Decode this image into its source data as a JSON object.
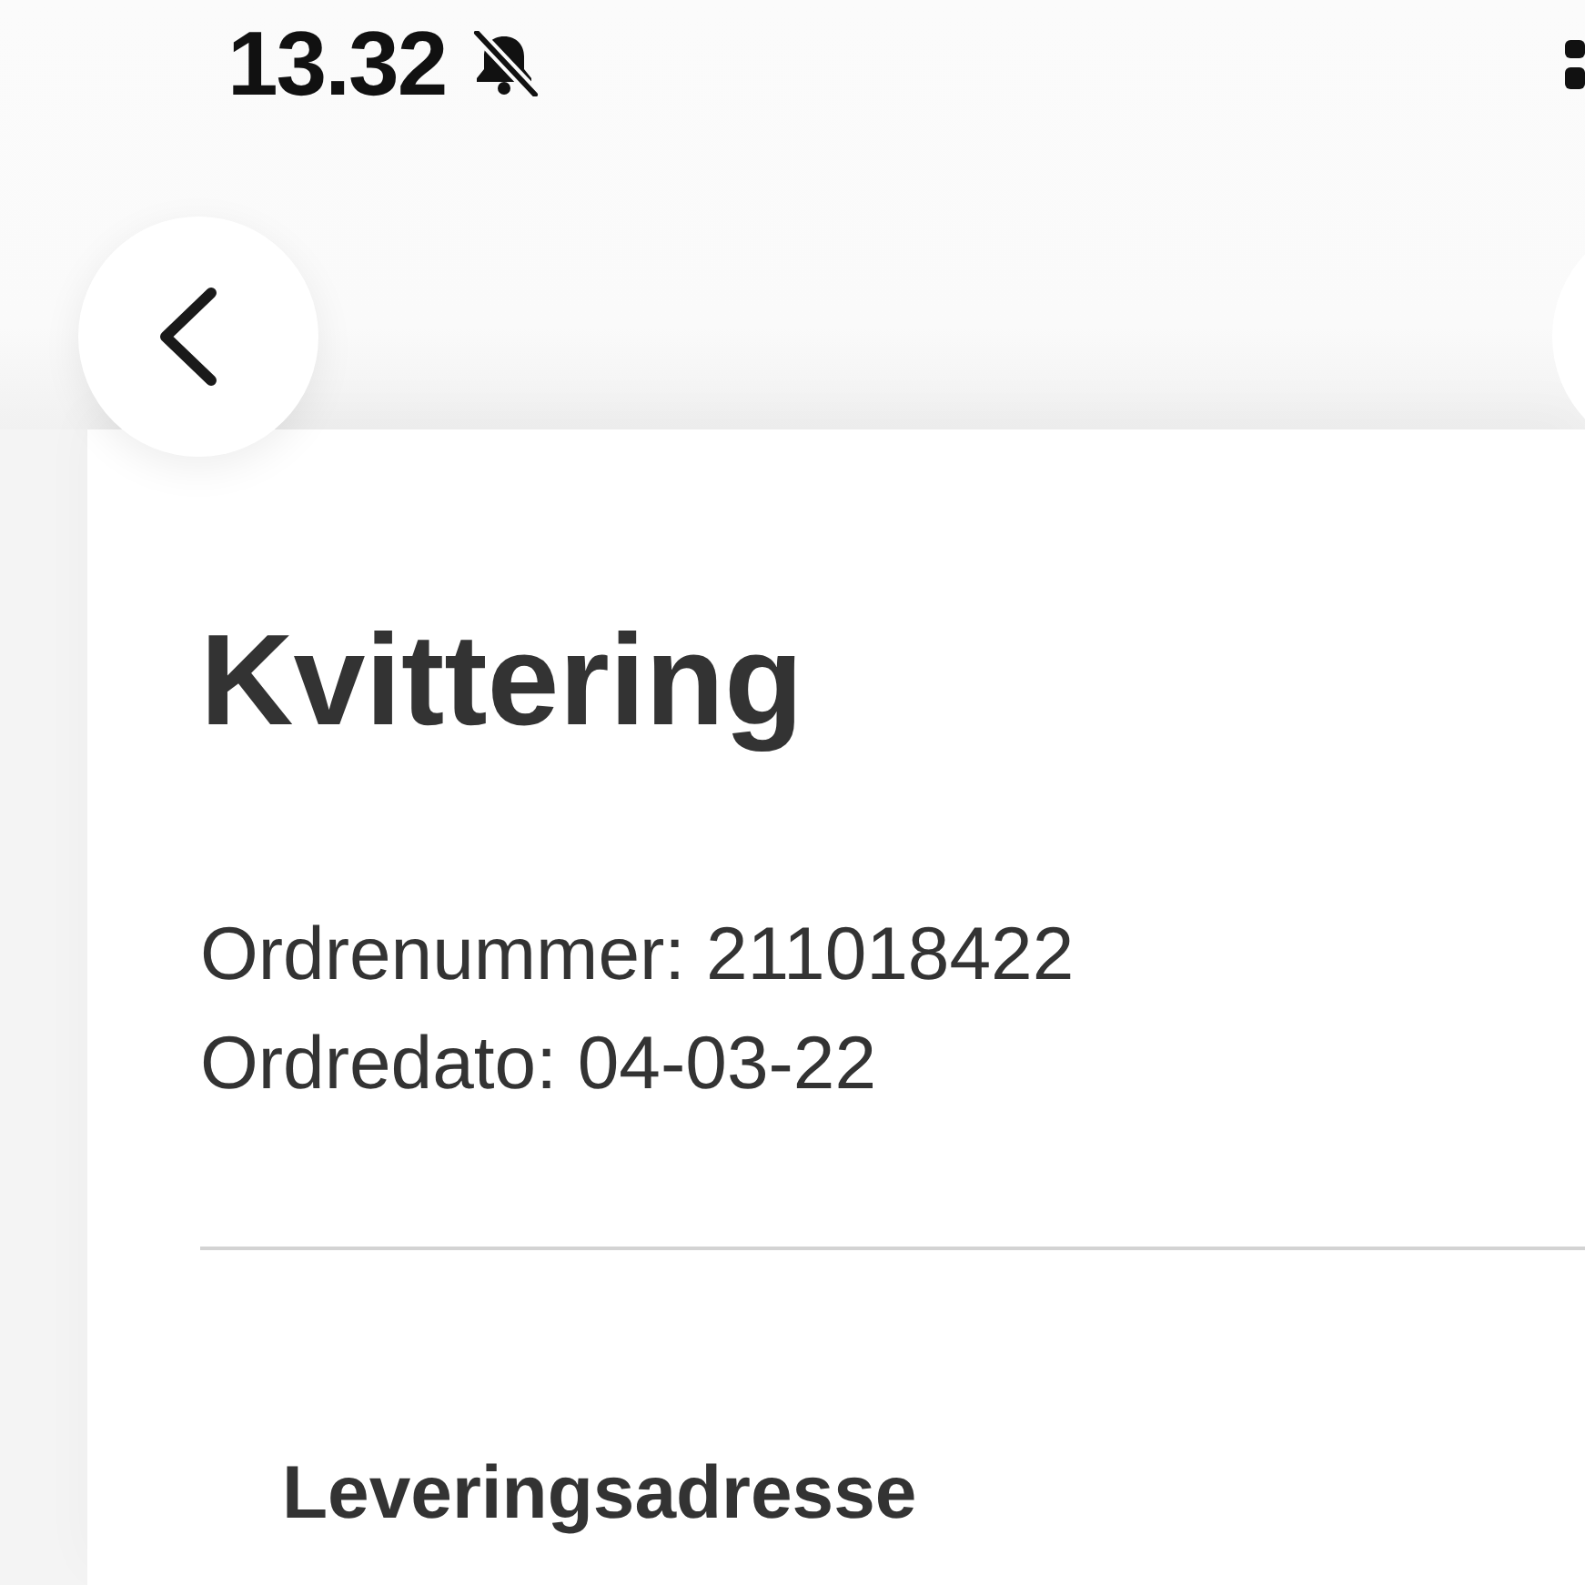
{
  "status_bar": {
    "time": "13.32",
    "silent": true
  },
  "receipt": {
    "title": "Kvittering",
    "details": [
      "Ordrenummer: 211018422",
      "Ordredato: 04-03-22"
    ],
    "sections": [
      {
        "heading": "Leveringsadresse"
      }
    ]
  }
}
